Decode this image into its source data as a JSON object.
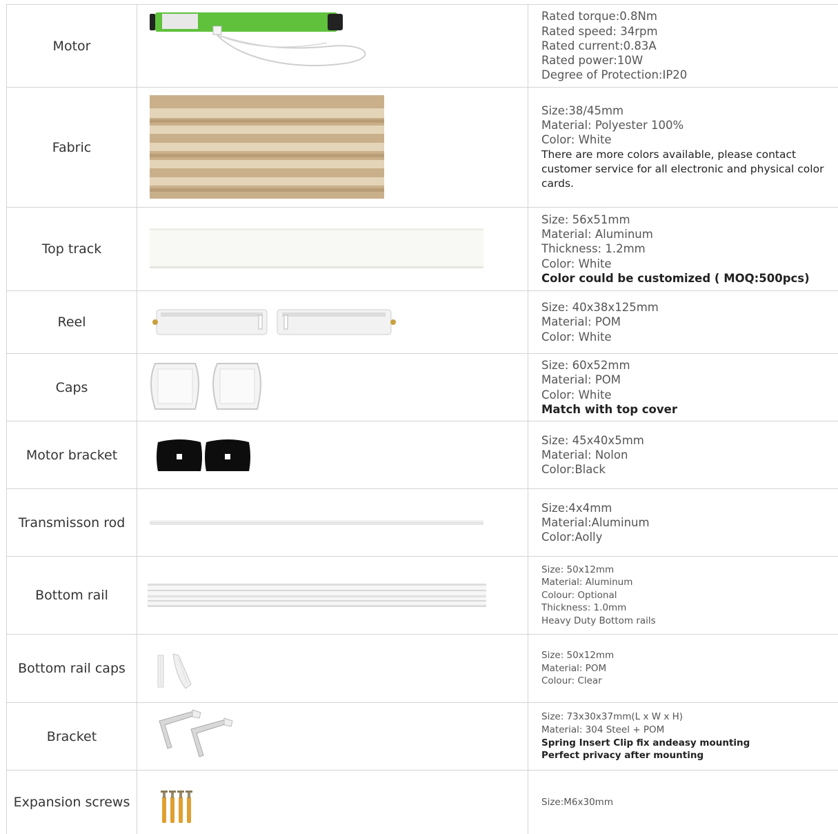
{
  "rows": [
    {
      "label": "Motor",
      "image": "tubular-motor",
      "specs": [
        {
          "text": "Rated torque:0.8Nm"
        },
        {
          "text": "Rated speed: 34rpm"
        },
        {
          "text": "Rated current:0.83A"
        },
        {
          "text": "Rated power:10W"
        },
        {
          "text": "Degree of Protection:IP20"
        }
      ]
    },
    {
      "label": "Fabric",
      "image": "honeycomb-fabric",
      "specs": [
        {
          "text": "Size:38/45mm"
        },
        {
          "text": "Material: Polyester 100%"
        },
        {
          "text": "Color: White"
        },
        {
          "text": "There are more colors available, please contact customer service for all electronic and physical color cards."
        }
      ]
    },
    {
      "label": "Top track",
      "image": "aluminum-top-track",
      "specs": [
        {
          "text": "Size: 56x51mm"
        },
        {
          "text": "Material: Aluminum"
        },
        {
          "text": "Thickness: 1.2mm"
        },
        {
          "text": "Color: White"
        },
        {
          "text": "Color could be customized ( MOQ:500pcs)"
        }
      ]
    },
    {
      "label": "Reel",
      "image": "reel",
      "specs": [
        {
          "text": "Size: 40x38x125mm"
        },
        {
          "text": "Material: POM"
        },
        {
          "text": "Color: White"
        }
      ]
    },
    {
      "label": "Caps",
      "image": "end-caps",
      "specs": [
        {
          "text": "Size: 60x52mm"
        },
        {
          "text": "Material: POM"
        },
        {
          "text": "Color: White"
        },
        {
          "text": "Match with top cover"
        }
      ]
    },
    {
      "label": "Motor bracket",
      "image": "motor-bracket",
      "specs": [
        {
          "text": "Size: 45x40x5mm"
        },
        {
          "text": "Material: Nolon"
        },
        {
          "text": "Color:Black"
        }
      ]
    },
    {
      "label": "Transmisson rod",
      "image": "transmission-rod",
      "specs": [
        {
          "text": "Size:4x4mm"
        },
        {
          "text": "Material:Aluminum"
        },
        {
          "text": "Color:Aolly"
        }
      ]
    },
    {
      "label": "Bottom rail",
      "image": "bottom-rail",
      "specs": [
        {
          "text": "Size: 50x12mm"
        },
        {
          "text": "Material: Aluminum"
        },
        {
          "text": "Colour: Optional"
        },
        {
          "text": "Thickness: 1.0mm"
        },
        {
          "text": "Heavy Duty Bottom rails"
        }
      ]
    },
    {
      "label": "Bottom rail caps",
      "image": "bottom-rail-caps",
      "specs": [
        {
          "text": "Size: 50x12mm"
        },
        {
          "text": "Material: POM"
        },
        {
          "text": "Colour: Clear"
        }
      ]
    },
    {
      "label": "Bracket",
      "image": "mounting-bracket",
      "specs": [
        {
          "text": "Size: 73x30x37mm(L x W x H)"
        },
        {
          "text": "Material: 304 Steel + POM"
        },
        {
          "text": "Spring Insert Clip fix andeasy mounting"
        },
        {
          "text": "Perfect privacy after mounting"
        }
      ]
    },
    {
      "label": "Expansion screws",
      "image": "expansion-screws",
      "specs": [
        {
          "text": "Size:M6x30mm"
        }
      ]
    }
  ],
  "colors": {
    "motor_green": "#5fc13c",
    "fabric_beige": "#c9b08a",
    "bracket_black": "#0d0d0d",
    "screw_orange": "#e0a030"
  }
}
